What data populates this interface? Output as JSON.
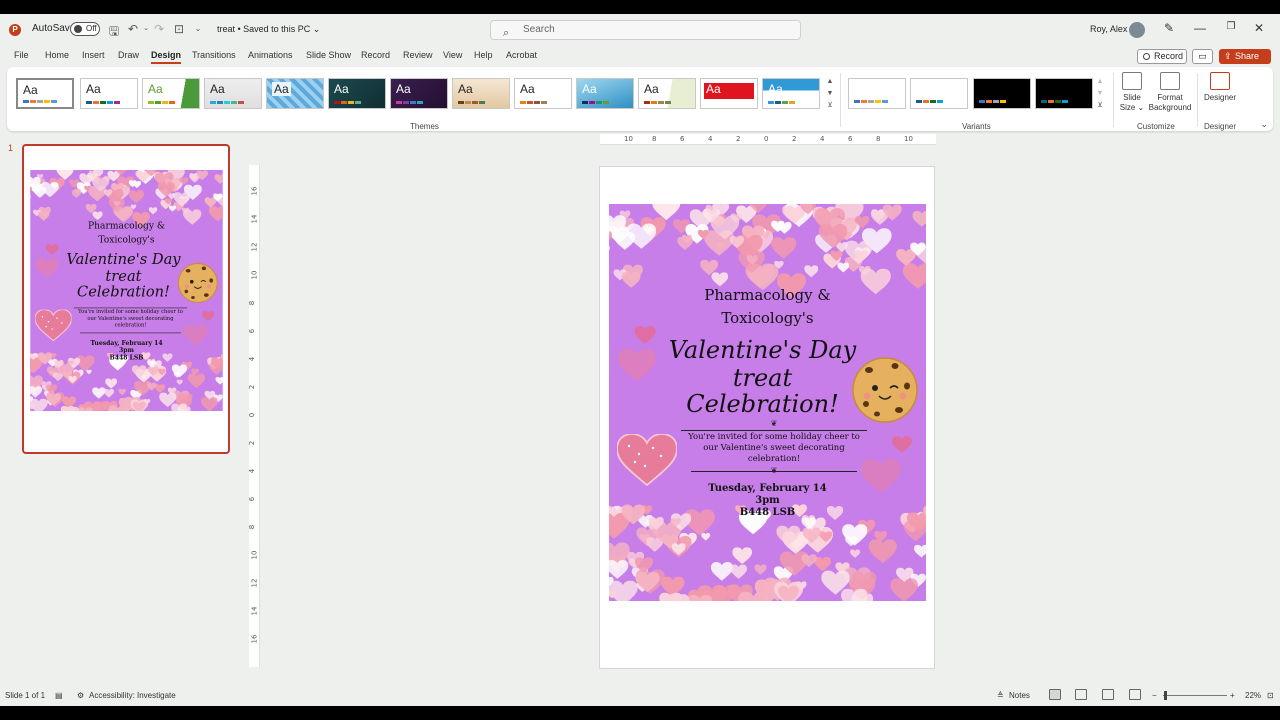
{
  "titlebar": {
    "autosave_label": "AutoSave",
    "autosave_state": "Off",
    "doc_title": "treat • Saved to this PC ⌄",
    "search_placeholder": "Search",
    "user_name": "Roy, Alex",
    "minimize": "—",
    "restore": "❐",
    "close": "✕"
  },
  "menu": {
    "tabs": [
      "File",
      "Home",
      "Insert",
      "Draw",
      "Design",
      "Transitions",
      "Animations",
      "Slide Show",
      "Record",
      "Review",
      "View",
      "Help",
      "Acrobat"
    ],
    "active_tab": "Design",
    "record_label": "Record",
    "share_label": "Share"
  },
  "ribbon": {
    "themes_label": "Themes",
    "variants_label": "Variants",
    "customize_label": "Customize",
    "designer_group_label": "Designer",
    "theme_sample": "Aa",
    "slide_size_label": "Slide Size ⌄",
    "format_background_label": "Format Background",
    "designer_label": "Designer"
  },
  "slide_panel": {
    "slide_number": "1"
  },
  "poster": {
    "line1": "Pharmacology &",
    "line2": "Toxicology's",
    "script1": "Valentine's Day",
    "script2": "treat",
    "script3": "Celebration!",
    "invite": "You're invited for some holiday cheer to our Valentine's sweet decorating celebration!",
    "date": "Tuesday, February 14",
    "time": "3pm",
    "room": "B448 LSB"
  },
  "statusbar": {
    "slide_info": "Slide 1 of 1",
    "accessibility": "Accessibility: Investigate",
    "notes": "Notes",
    "zoom_minus": "−",
    "zoom_plus": "+",
    "zoom_level": "22%"
  },
  "colors": {
    "accent": "#c43e1c",
    "poster_bg": "#c77ee8",
    "heart_pink": "#f2a7b8"
  }
}
